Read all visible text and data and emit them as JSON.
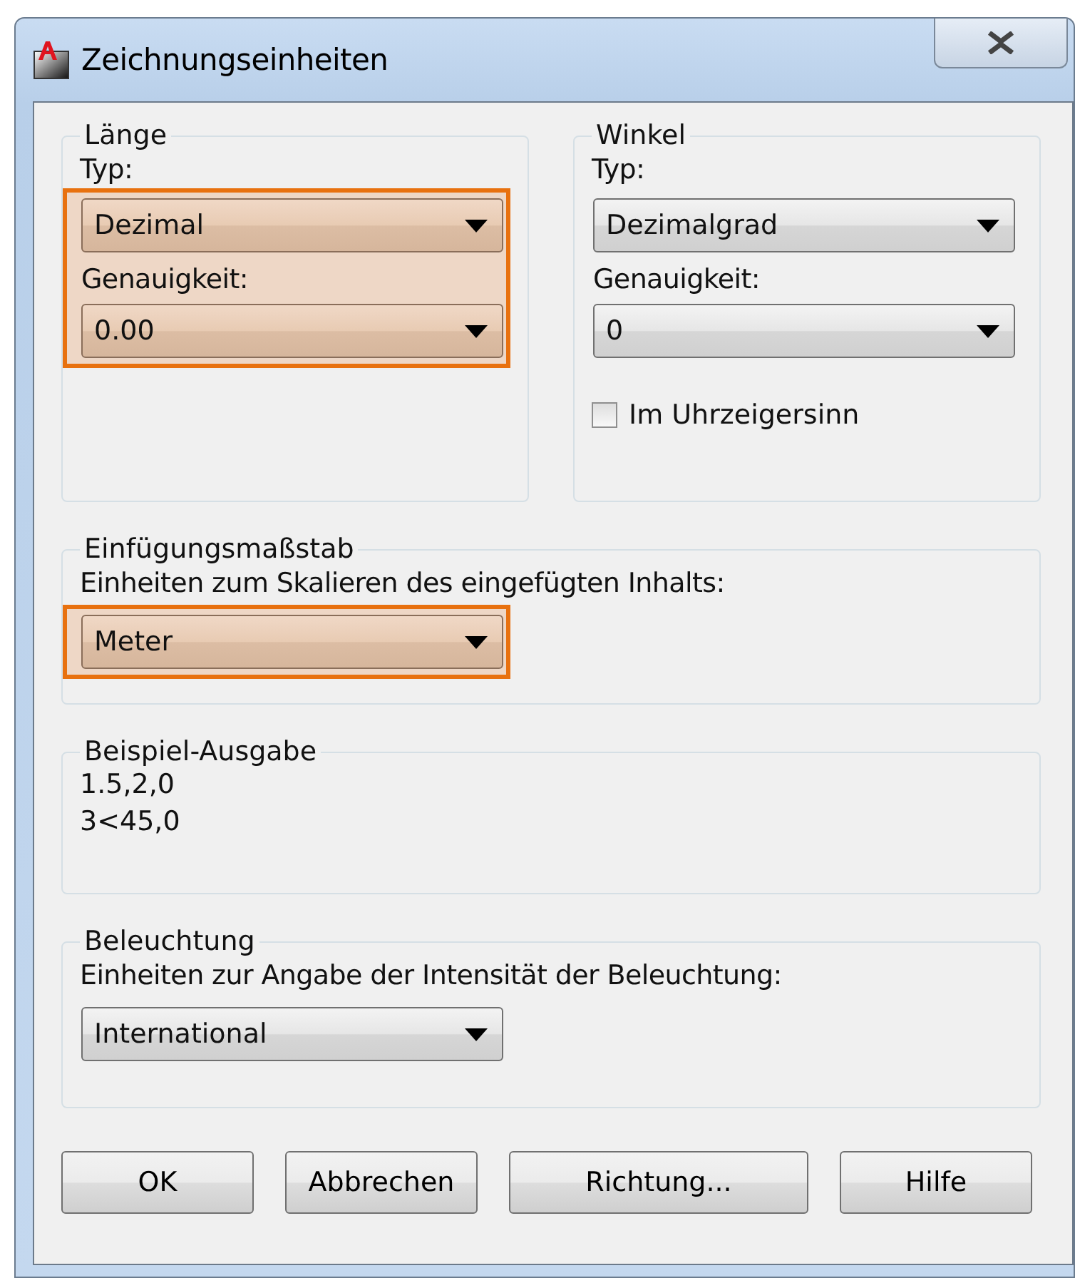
{
  "window": {
    "title": "Zeichnungseinheiten"
  },
  "length": {
    "title": "Länge",
    "type_label": "Typ:",
    "type_value": "Dezimal",
    "precision_label": "Genauigkeit:",
    "precision_value": "0.00",
    "highlighted": true
  },
  "angle": {
    "title": "Winkel",
    "type_label": "Typ:",
    "type_value": "Dezimalgrad",
    "precision_label": "Genauigkeit:",
    "precision_value": "0",
    "clockwise": {
      "label": "Im Uhrzeigersinn",
      "checked": false
    }
  },
  "insertion": {
    "title": "Einfügungsmaßstab",
    "label": "Einheiten zum Skalieren des eingefügten Inhalts:",
    "value": "Meter",
    "highlighted": true
  },
  "sample": {
    "title": "Beispiel-Ausgabe",
    "lines": [
      "1.5,2,0",
      "3<45,0"
    ]
  },
  "lighting": {
    "title": "Beleuchtung",
    "label": "Einheiten zur Angabe der Intensität der Beleuchtung:",
    "value": "International",
    "highlighted": false
  },
  "buttons": [
    "OK",
    "Abbrechen",
    "Richtung...",
    "Hilfe"
  ]
}
